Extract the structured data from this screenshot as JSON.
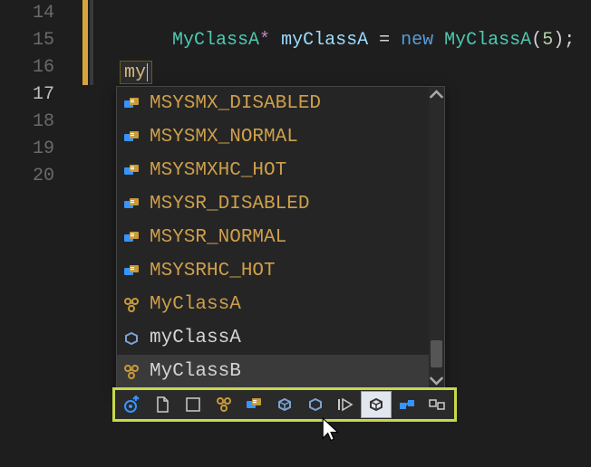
{
  "gutter": {
    "lines": [
      "14",
      "15",
      "16",
      "17",
      "18",
      "19",
      "20"
    ],
    "current_index": 3
  },
  "code": {
    "line15": {
      "type1": "MyClassA",
      "star": "*",
      "var": "myClassA",
      "eq": "=",
      "kw_new": "new",
      "type2": "MyClassA",
      "open": "(",
      "arg": "5",
      "close": ")",
      "semi": ";"
    },
    "typed": "my"
  },
  "autocomplete": {
    "items": [
      {
        "label": "MSYSMX_DISABLED",
        "kind": "enum"
      },
      {
        "label": "MSYSMX_NORMAL",
        "kind": "enum"
      },
      {
        "label": "MSYSMXHC_HOT",
        "kind": "enum"
      },
      {
        "label": "MSYSR_DISABLED",
        "kind": "enum"
      },
      {
        "label": "MSYSR_NORMAL",
        "kind": "enum"
      },
      {
        "label": "MSYSRHC_HOT",
        "kind": "enum"
      },
      {
        "label": "MyClassA",
        "kind": "class"
      },
      {
        "label": "myClassA",
        "kind": "variable",
        "alt": true
      },
      {
        "label": "MyClassB",
        "kind": "class",
        "selected": true
      }
    ],
    "filters": [
      {
        "name": "target-up",
        "active": false
      },
      {
        "name": "file",
        "active": false
      },
      {
        "name": "namespace",
        "active": false
      },
      {
        "name": "class",
        "active": false
      },
      {
        "name": "enum",
        "active": false
      },
      {
        "name": "field",
        "active": false
      },
      {
        "name": "variable",
        "active": false
      },
      {
        "name": "play",
        "active": false
      },
      {
        "name": "struct",
        "active": true
      },
      {
        "name": "interface",
        "active": false
      },
      {
        "name": "snippet",
        "active": false
      }
    ]
  }
}
